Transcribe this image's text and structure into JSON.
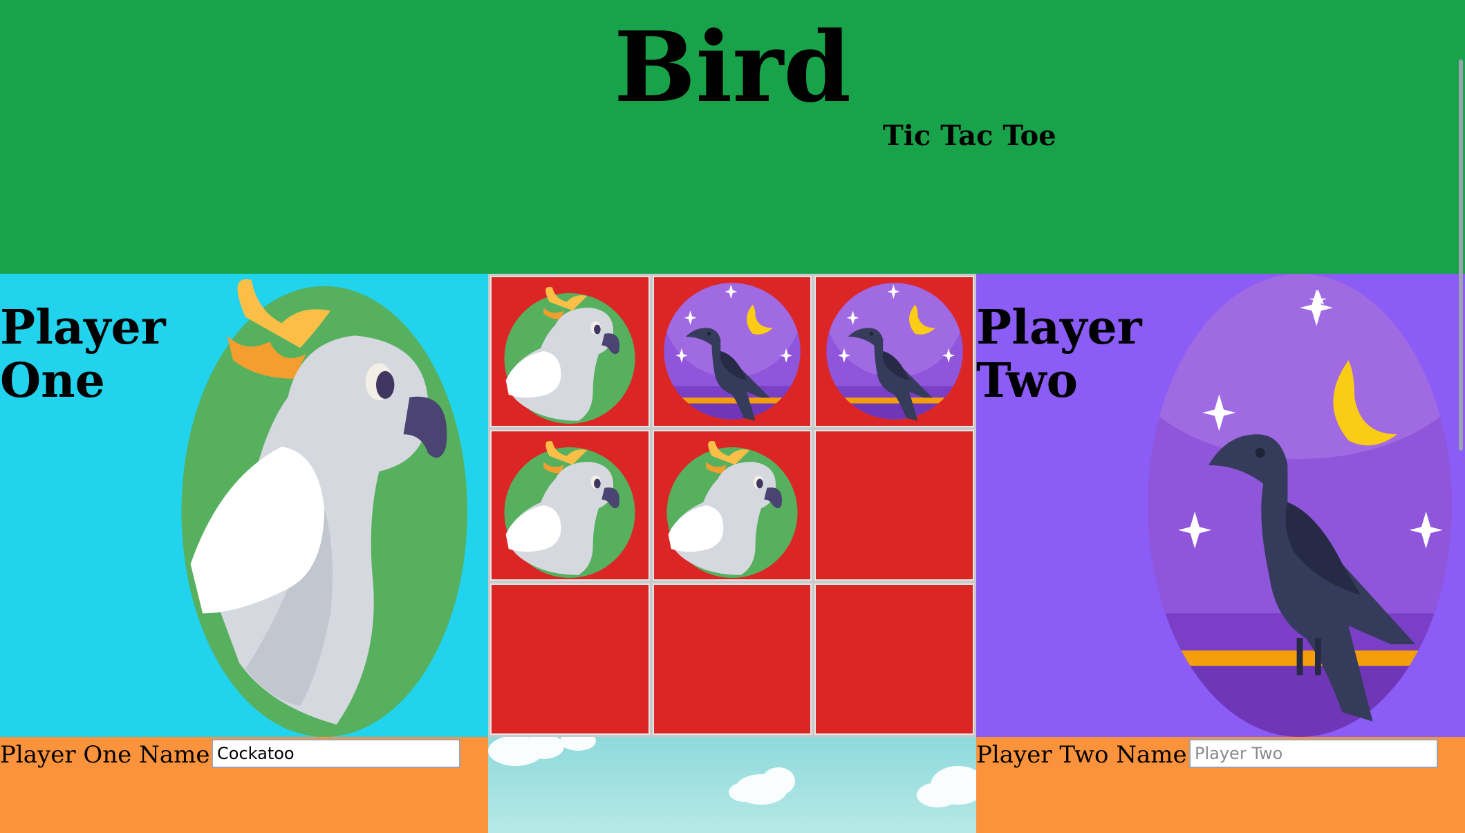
{
  "header": {
    "title": "Bird",
    "subtitle": "Tic Tac Toe"
  },
  "player_one": {
    "heading": "Player One",
    "name_label": "Player One Name:",
    "name_value": "Cockatoo",
    "name_placeholder": "",
    "bird": "cockatoo"
  },
  "player_two": {
    "heading": "Player Two",
    "name_label": "Player Two Name:",
    "name_value": "",
    "name_placeholder": "Player Two",
    "bird": "crow"
  },
  "board": {
    "cells": [
      "cockatoo",
      "crow",
      "crow",
      "cockatoo",
      "cockatoo",
      "",
      "",
      "",
      ""
    ]
  },
  "colors": {
    "header": "#18a34a",
    "player_one_panel": "#22d3ee",
    "player_two_panel": "#8b5cf6",
    "cell": "#dc2626",
    "footer": "#fb923c"
  }
}
